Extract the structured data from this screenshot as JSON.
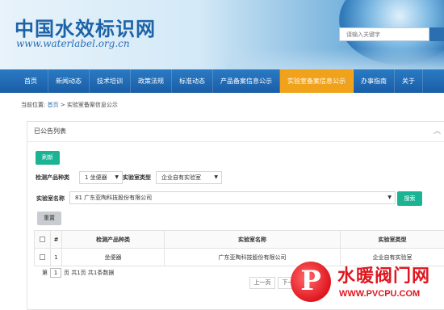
{
  "header": {
    "site_title": "中国水效标识网",
    "site_url": "www.waterlabel.org.cn",
    "search_placeholder": "请输入关键字"
  },
  "nav": {
    "items": [
      "首页",
      "新闻动态",
      "技术培训",
      "政策法规",
      "标准动态",
      "产品备案信息公示",
      "实验室备案信息公示",
      "办事指南",
      "关于"
    ],
    "active_index": 6,
    "active_color": "#f0a21a"
  },
  "breadcrumb": {
    "prefix": "当前位置:",
    "home": "首页",
    "sep": ">",
    "current": "实验室备案信息公示"
  },
  "panel": {
    "title": "已公告列表",
    "collapse_icon": "chevron-up-icon",
    "refresh_label": "刷新",
    "filter": {
      "category_label": "检测产品种类",
      "category_value": "1 坐便器",
      "type_label": "实验室类型",
      "type_value": "企业自有实验室",
      "name_label": "实验室名称",
      "name_value": "81 广东亚陶科技股份有限公司"
    },
    "search_label": "搜索",
    "reset_label": "重置"
  },
  "table": {
    "headers": [
      "",
      "#",
      "检测产品种类",
      "实验室名称",
      "实验室类型"
    ],
    "rows": [
      {
        "index": "1",
        "category": "坐便器",
        "name": "广东亚陶科技股份有限公司",
        "type": "企业自有实验室"
      }
    ]
  },
  "pager": {
    "prefix": "第",
    "page": "1",
    "suffix": "页 共1页 共1条数据",
    "prev": "上一页",
    "next": "下一页"
  },
  "watermark": {
    "logo_letter": "P",
    "cn": "水暖阀门网",
    "url": "WWW.PVCPU.COM"
  }
}
